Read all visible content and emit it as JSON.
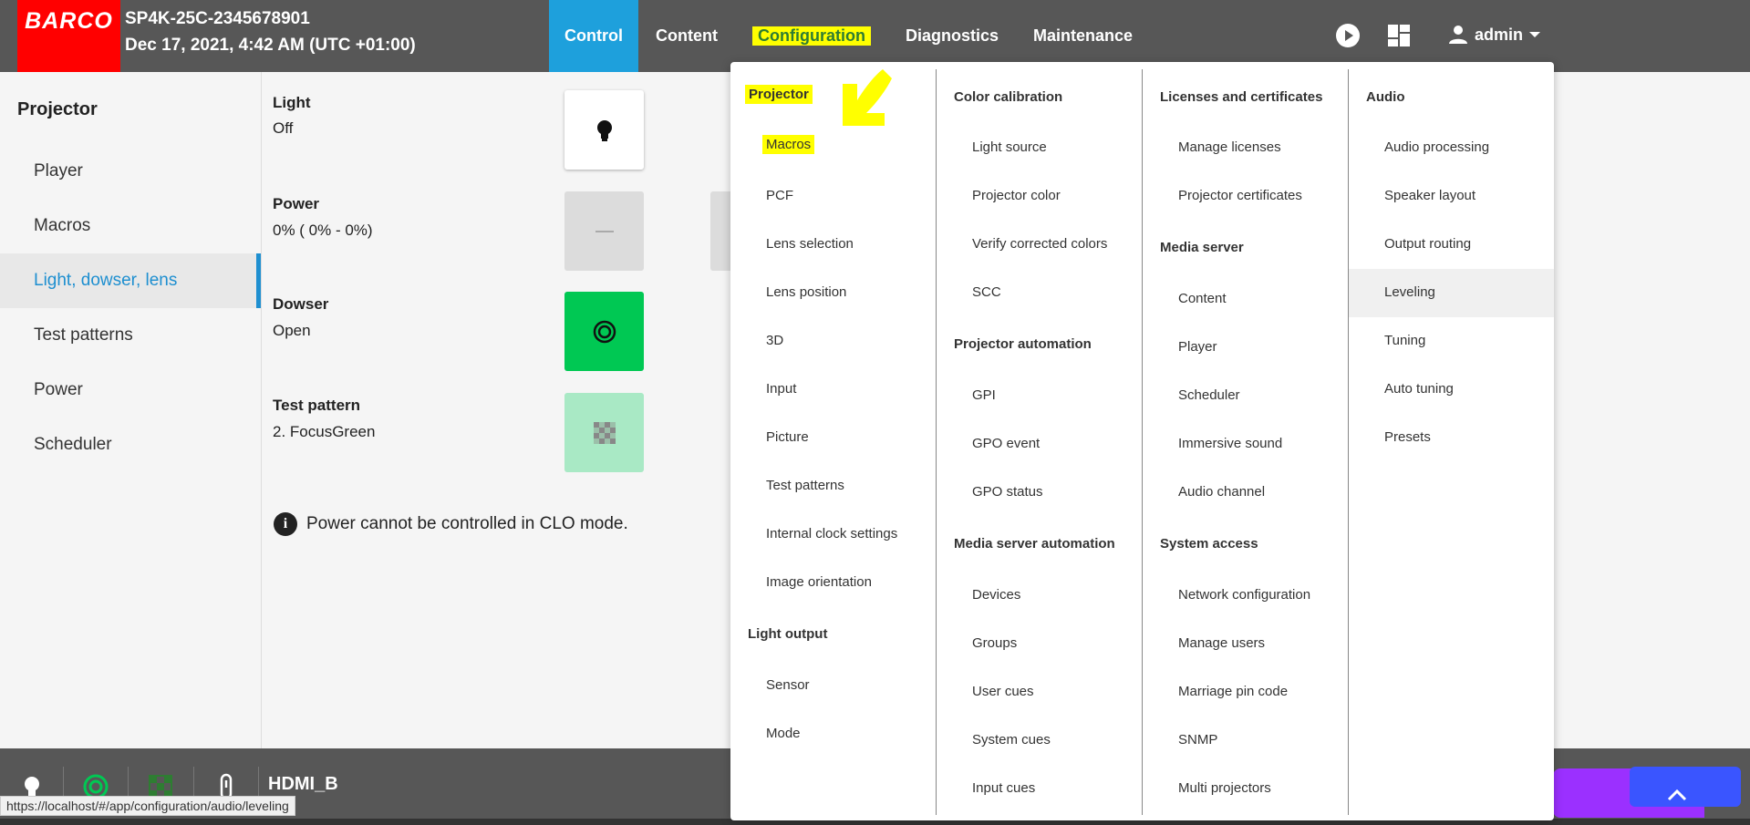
{
  "header": {
    "logo": "BARCO",
    "device_name": "SP4K-25C-2345678901",
    "datetime": "Dec 17, 2021, 4:42 AM (UTC +01:00)",
    "nav": [
      "Control",
      "Content",
      "Configuration",
      "Diagnostics",
      "Maintenance"
    ],
    "user": "admin"
  },
  "sidebar": {
    "title": "Projector",
    "items": [
      "Player",
      "Macros",
      "Light, dowser, lens",
      "Test patterns",
      "Power",
      "Scheduler"
    ]
  },
  "main": {
    "light": {
      "label": "Light",
      "value": "Off"
    },
    "power": {
      "label": "Power",
      "value": "0% ( 0% - 0%)"
    },
    "dowser": {
      "label": "Dowser",
      "value": "Open"
    },
    "test_pattern": {
      "label": "Test pattern",
      "value": "2. FocusGreen"
    },
    "info": "Power cannot be controlled in CLO mode."
  },
  "statusbar": {
    "source": "HDMI_B",
    "url": "https://localhost/#/app/configuration/audio/leveling"
  },
  "menu": {
    "col1": {
      "heading": "Projector",
      "items": [
        "Macros",
        "PCF",
        "Lens selection",
        "Lens position",
        "3D",
        "Input",
        "Picture",
        "Test patterns",
        "Internal clock settings",
        "Image orientation"
      ],
      "heading2": "Light output",
      "items2": [
        "Sensor",
        "Mode"
      ]
    },
    "col2": {
      "heading": "Color calibration",
      "items": [
        "Light source",
        "Projector color",
        "Verify corrected colors",
        "SCC"
      ],
      "heading2": "Projector automation",
      "items2": [
        "GPI",
        "GPO event",
        "GPO status"
      ],
      "heading3": "Media server automation",
      "items3": [
        "Devices",
        "Groups",
        "User cues",
        "System cues",
        "Input cues"
      ]
    },
    "col3": {
      "heading": "Licenses and certificates",
      "items": [
        "Manage licenses",
        "Projector certificates"
      ],
      "heading2": "Media server",
      "items2": [
        "Content",
        "Player",
        "Scheduler",
        "Immersive sound",
        "Audio channel"
      ],
      "heading3": "System access",
      "items3": [
        "Network configuration",
        "Manage users",
        "Marriage pin code",
        "SNMP",
        "Multi projectors"
      ]
    },
    "col4": {
      "heading": "Audio",
      "items": [
        "Audio processing",
        "Speaker layout",
        "Output routing",
        "Leveling",
        "Tuning",
        "Auto tuning",
        "Presets"
      ]
    }
  },
  "colors": {
    "header_bg": "#575757",
    "accent_blue": "#1ea0dc",
    "logo_red": "#ff0000",
    "dowser_green": "#00c853",
    "highlight_yellow": "#ffff00"
  }
}
